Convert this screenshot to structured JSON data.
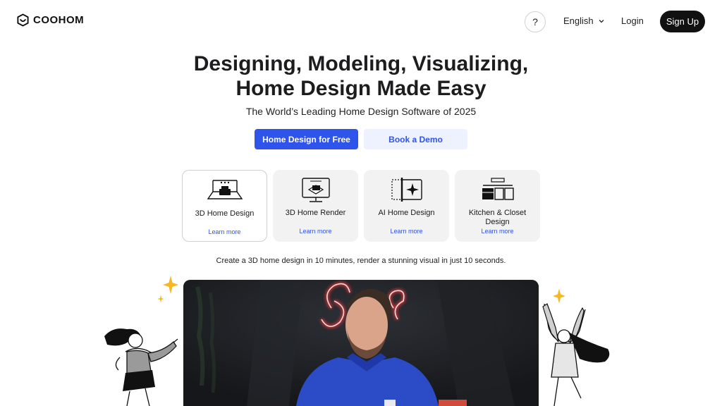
{
  "header": {
    "logo_text": "COOHOM",
    "help_label": "?",
    "language": "English",
    "login_label": "Login",
    "signup_label": "Sign Up"
  },
  "hero": {
    "headline_line1": "Designing, Modeling, Visualizing,",
    "headline_line2": "Home Design Made Easy",
    "subheadline": "The World’s Leading Home Design Software of 2025",
    "primary_cta": "Home Design for Free",
    "secondary_cta": "Book a Demo"
  },
  "features": [
    {
      "title": "3D Home Design",
      "link": "Learn more",
      "icon": "room-icon"
    },
    {
      "title": "3D Home Render",
      "link": "Learn more",
      "icon": "monitor-render-icon"
    },
    {
      "title": "AI Home Design",
      "link": "Learn more",
      "icon": "ai-sparkle-icon"
    },
    {
      "title": "Kitchen & Closet Design",
      "link": "Learn more",
      "icon": "cabinet-icon"
    }
  ],
  "tagline": "Create a 3D home design in 10 minutes, render a stunning visual in just 10 seconds.",
  "colors": {
    "accent": "#2f54eb",
    "accent_light": "#eef2ff",
    "dark": "#111111",
    "sparkle": "#f5b820",
    "neon": "#ff3b3b"
  }
}
